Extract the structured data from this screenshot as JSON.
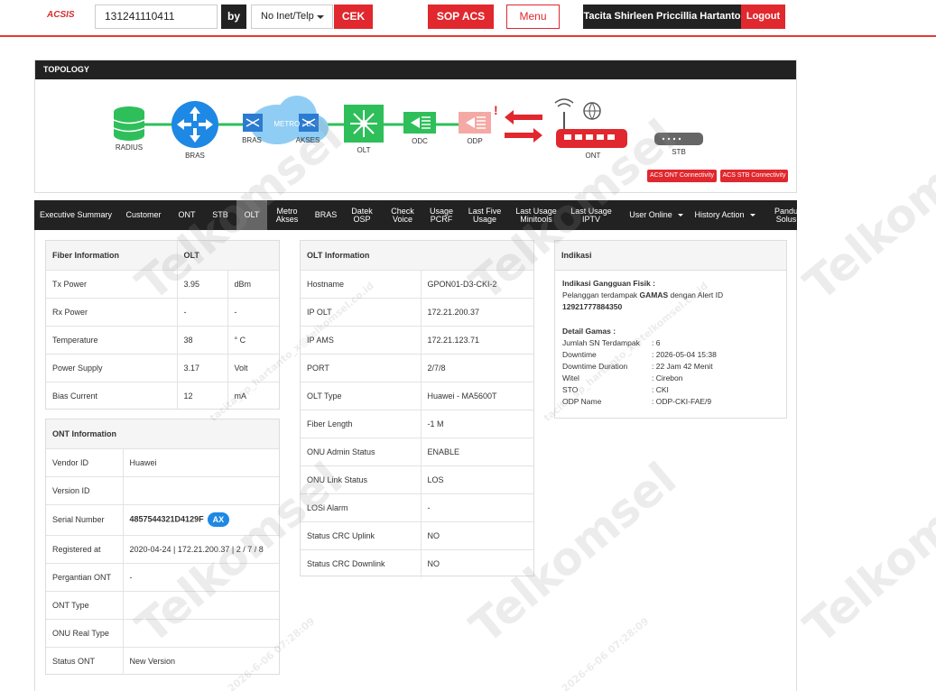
{
  "header": {
    "logo": "ACSIS",
    "search_value": "131241110411",
    "by_label": "by",
    "search_type": "No Inet/Telp",
    "check_button": "CEK",
    "sop_button": "SOP ACS",
    "menu_button": "Menu",
    "user_name": "Tacita Shirleen Priccillia Hartanto",
    "logout_button": "Logout"
  },
  "topology": {
    "title": "TOPOLOGY",
    "nodes": {
      "radius": "RADIUS",
      "bras": "BRAS",
      "bras2": "BRAS",
      "metro": "METRO - E",
      "akses": "AKSES",
      "olt": "OLT",
      "odc": "ODC",
      "odp": "ODP",
      "ont": "ONT",
      "stb": "STB"
    },
    "alarm_mark": "!",
    "acs_ont_button": "ACS ONT Connectivity",
    "acs_stb_button": "ACS STB Connectivity"
  },
  "tabs": [
    {
      "label": "Executive Summary"
    },
    {
      "label": "Customer"
    },
    {
      "label": "ONT"
    },
    {
      "label": "STB"
    },
    {
      "label": "OLT"
    },
    {
      "label": "Metro\nAkses"
    },
    {
      "label": "BRAS"
    },
    {
      "label": "Datek\nOSP"
    },
    {
      "label": "Check\nVoice"
    },
    {
      "label": "Usage\nPCRF"
    },
    {
      "label": "Last Five\nUsage"
    },
    {
      "label": "Last Usage\nMinitools"
    },
    {
      "label": "Last Usage\nIPTV"
    },
    {
      "label": "User Online"
    },
    {
      "label": "History Action"
    },
    {
      "label": "Pandu\nSolus"
    }
  ],
  "fiber": {
    "title": "Fiber Information",
    "col": "OLT",
    "rows": [
      {
        "label": "Tx Power",
        "value": "3.95",
        "unit": "dBm"
      },
      {
        "label": "Rx Power",
        "value": "-",
        "unit": "-"
      },
      {
        "label": "Temperature",
        "value": "38",
        "unit": "° C"
      },
      {
        "label": "Power Supply",
        "value": "3.17",
        "unit": "Volt"
      },
      {
        "label": "Bias Current",
        "value": "12",
        "unit": "mA"
      }
    ]
  },
  "ont": {
    "title": "ONT Information",
    "rows": [
      {
        "label": "Vendor ID",
        "value": "Huawei"
      },
      {
        "label": "Version ID",
        "value": ""
      },
      {
        "label": "Serial Number",
        "value": "4857544321D4129F"
      },
      {
        "label": "Registered at",
        "value": "2020-04-24 | 172.21.200.37 | 2 / 7 / 8"
      },
      {
        "label": "Pergantian ONT",
        "value": "-"
      },
      {
        "label": "ONT Type",
        "value": ""
      },
      {
        "label": "ONU Real Type",
        "value": ""
      },
      {
        "label": "Status ONT",
        "value": "New Version"
      }
    ],
    "badge": "AX"
  },
  "olt": {
    "title": "OLT Information",
    "rows": [
      {
        "label": "Hostname",
        "value": "GPON01-D3-CKI-2"
      },
      {
        "label": "IP OLT",
        "value": "172.21.200.37"
      },
      {
        "label": "IP AMS",
        "value": "172.21.123.71"
      },
      {
        "label": "PORT",
        "value": "2/7/8"
      },
      {
        "label": "OLT Type",
        "value": "Huawei - MA5600T"
      },
      {
        "label": "Fiber Length",
        "value": "-1 M"
      },
      {
        "label": "ONU Admin Status",
        "value": "ENABLE"
      },
      {
        "label": "ONU Link Status",
        "value": "LOS"
      },
      {
        "label": "LOSi Alarm",
        "value": "-"
      },
      {
        "label": "Status CRC Uplink",
        "value": "NO"
      },
      {
        "label": "Status CRC Downlink",
        "value": "NO"
      }
    ]
  },
  "indikasi": {
    "title": "Indikasi",
    "heading": "Indikasi Gangguan Fisik :",
    "text_prefix": "Pelanggan terdampak ",
    "text_bold": "GAMAS",
    "text_suffix": " dengan Alert ID",
    "alert_id": "12921777884350",
    "detail_heading": "Detail Gamas :",
    "details": [
      {
        "label": "Jumlah SN Terdampak",
        "value": ": 6"
      },
      {
        "label": "Downtime",
        "value": ": 2026-05-04 15:38"
      },
      {
        "label": "Downtime Duration",
        "value": ": 22 Jam 42 Menit"
      },
      {
        "label": "Witel",
        "value": ": Cirebon"
      },
      {
        "label": "STO",
        "value": ": CKI"
      },
      {
        "label": "ODP Name",
        "value": ": ODP-CKI-FAE/9"
      }
    ]
  },
  "watermark": {
    "brand": "Telkomsel",
    "user_line": "tacita_sp_hartanto_x@telkomsel.co.id",
    "date_line": "2026-6-06 07:28:09"
  },
  "colors": {
    "accent_red": "#e0282e",
    "dark": "#222222",
    "green": "#2ebf5a",
    "blue": "#1e88e5"
  }
}
